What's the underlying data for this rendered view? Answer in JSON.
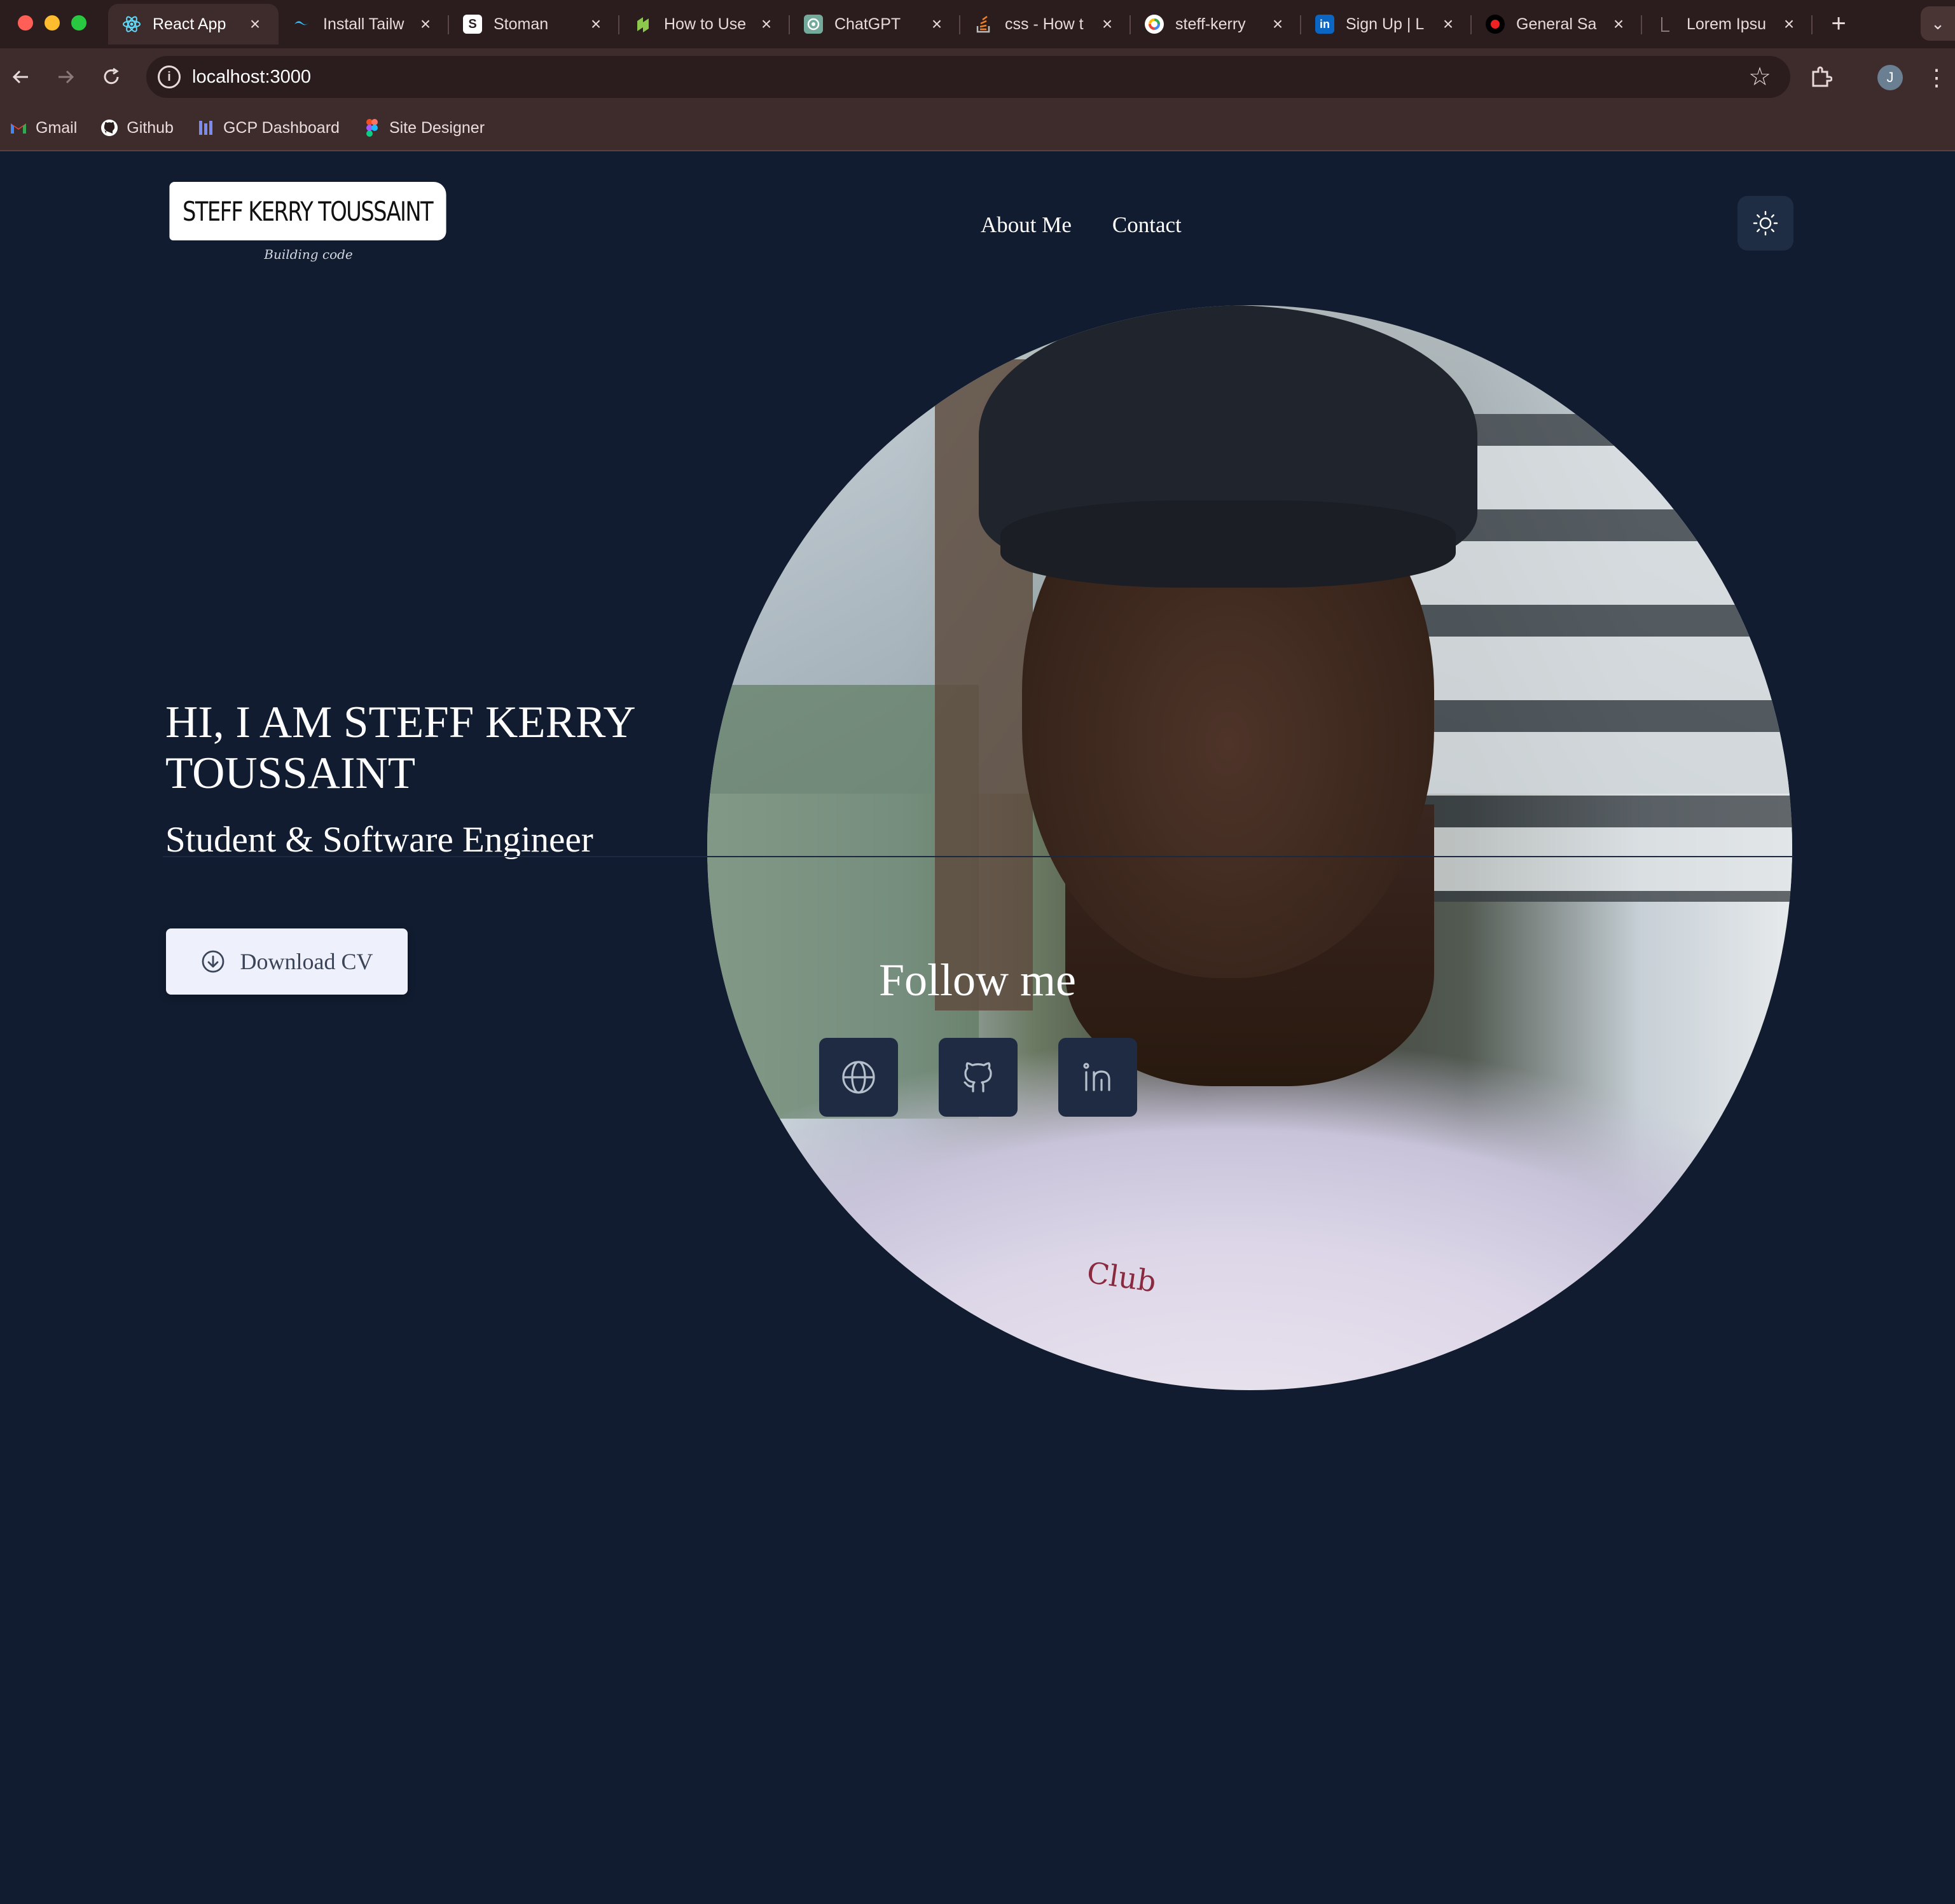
{
  "browser": {
    "tabs": [
      {
        "title": "React App",
        "active": true,
        "icon": "react-icon"
      },
      {
        "title": "Install Tailw",
        "active": false,
        "icon": "tailwind-icon"
      },
      {
        "title": "Stoman",
        "active": false,
        "icon": "stoman-icon"
      },
      {
        "title": "How to Use",
        "active": false,
        "icon": "nodejs-icon"
      },
      {
        "title": "ChatGPT",
        "active": false,
        "icon": "chatgpt-icon"
      },
      {
        "title": "css - How t",
        "active": false,
        "icon": "stackoverflow-icon"
      },
      {
        "title": "steff-kerry",
        "active": false,
        "icon": "google-icon"
      },
      {
        "title": "Sign Up | L",
        "active": false,
        "icon": "linkedin-icon"
      },
      {
        "title": "General Sa",
        "active": false,
        "icon": "record-icon"
      },
      {
        "title": "Lorem Ipsu",
        "active": false,
        "icon": "lorem-icon"
      }
    ],
    "url": "localhost:3000",
    "profile_initial": "J",
    "bookmarks": [
      {
        "label": "Gmail",
        "icon": "gmail-icon"
      },
      {
        "label": "Github",
        "icon": "github-icon"
      },
      {
        "label": "GCP Dashboard",
        "icon": "gcp-icon"
      },
      {
        "label": "Site Designer",
        "icon": "figma-icon"
      }
    ]
  },
  "header": {
    "logo_text": "STEFF KERRY TOUSSAINT",
    "logo_sub": "Building code",
    "nav": [
      "About Me",
      "Contact"
    ],
    "theme_icon": "sun-icon"
  },
  "hero": {
    "title": "HI, I AM STEFF KERRY TOUSSAINT",
    "subtitle": "Student & Software Engineer",
    "cv_button": "Download CV",
    "shirt_print": "Club"
  },
  "follow": {
    "title": "Follow me",
    "links": [
      "globe-icon",
      "github-icon",
      "linkedin-icon"
    ]
  },
  "colors": {
    "page_bg": "#111c30",
    "card_bg": "#1e2b42",
    "button_bg": "#eef0fb",
    "chrome_bg": "#3e2b2b"
  }
}
